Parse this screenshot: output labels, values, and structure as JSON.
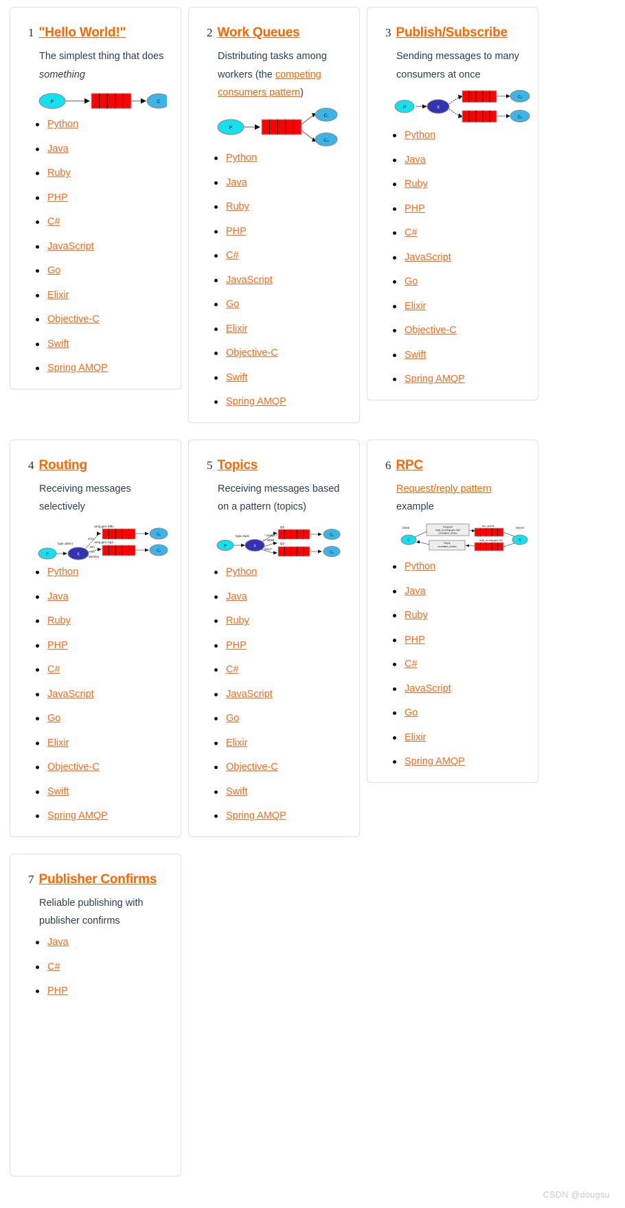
{
  "watermark": "CSDN @dougsu",
  "languages_full": [
    "Python",
    "Java",
    "Ruby",
    "PHP",
    "C#",
    "JavaScript",
    "Go",
    "Elixir",
    "Objective-C",
    "Swift",
    "Spring AMQP"
  ],
  "cards": [
    {
      "number": "1",
      "title": "\"Hello World!\"",
      "desc_prefix": "The simplest thing that does ",
      "desc_em": "something",
      "desc_link": "",
      "desc_suffix": "",
      "diagram": "hello-world-diagram",
      "diagram_labels": {
        "producer": "P",
        "consumer": "C"
      },
      "languages": [
        "Python",
        "Java",
        "Ruby",
        "PHP",
        "C#",
        "JavaScript",
        "Go",
        "Elixir",
        "Objective-C",
        "Swift",
        "Spring AMQP"
      ]
    },
    {
      "number": "2",
      "title": "Work Queues",
      "desc_prefix": "Distributing tasks among workers (the ",
      "desc_em": "",
      "desc_link": "competing consumers pattern",
      "desc_suffix": ")",
      "diagram": "work-queues-diagram",
      "diagram_labels": {
        "producer": "P",
        "consumer1": "C₁",
        "consumer2": "C₂"
      },
      "languages": [
        "Python",
        "Java",
        "Ruby",
        "PHP",
        "C#",
        "JavaScript",
        "Go",
        "Elixir",
        "Objective-C",
        "Swift",
        "Spring AMQP"
      ]
    },
    {
      "number": "3",
      "title": "Publish/Subscribe",
      "desc_prefix": "Sending messages to many consumers at once",
      "desc_em": "",
      "desc_link": "",
      "desc_suffix": "",
      "diagram": "publish-subscribe-diagram",
      "diagram_labels": {
        "producer": "P",
        "exchange": "X",
        "consumer1": "C₁",
        "consumer2": "C₂"
      },
      "languages": [
        "Python",
        "Java",
        "Ruby",
        "PHP",
        "C#",
        "JavaScript",
        "Go",
        "Elixir",
        "Objective-C",
        "Swift",
        "Spring AMQP"
      ]
    },
    {
      "number": "4",
      "title": "Routing",
      "desc_prefix": "Receiving messages selectively",
      "desc_em": "",
      "desc_link": "",
      "desc_suffix": "",
      "diagram": "routing-diagram",
      "diagram_labels": {
        "producer": "P",
        "exchange": "X",
        "exchange_type": "type=direct",
        "queue1": "amq.gen-S9b...",
        "queue2": "amq.gen-Ag1...",
        "key_error": "error",
        "key_info": "info",
        "key_warning": "warning",
        "consumer1": "C₁",
        "consumer2": "C₂"
      },
      "languages": [
        "Python",
        "Java",
        "Ruby",
        "PHP",
        "C#",
        "JavaScript",
        "Go",
        "Elixir",
        "Objective-C",
        "Swift",
        "Spring AMQP"
      ]
    },
    {
      "number": "5",
      "title": "Topics",
      "desc_prefix": "Receiving messages based on a pattern (topics)",
      "desc_em": "",
      "desc_link": "",
      "desc_suffix": "",
      "diagram": "topics-diagram",
      "diagram_labels": {
        "producer": "P",
        "exchange": "X",
        "exchange_type": "type=topic",
        "queue1": "Q1",
        "queue2": "Q2",
        "key1": "*.orange.*",
        "key2": "*.*.rabbit",
        "key3": "lazy.#",
        "consumer1": "C₁",
        "consumer2": "C₂"
      },
      "languages": [
        "Python",
        "Java",
        "Ruby",
        "PHP",
        "C#",
        "JavaScript",
        "Go",
        "Elixir",
        "Objective-C",
        "Swift",
        "Spring AMQP"
      ]
    },
    {
      "number": "6",
      "title": "RPC",
      "desc_prefix": "",
      "desc_em": "",
      "desc_link": "Request/reply pattern",
      "desc_suffix": " example",
      "diagram": "rpc-diagram",
      "diagram_labels": {
        "client": "Client",
        "client_node": "C",
        "server": "Server",
        "server_node": "S",
        "request_box": "Request reply_to=amqp.gen-Xa2 correlation_id=abc",
        "reply_box": "Reply correlation_id=abc",
        "rpc_queue": "rpc_queue",
        "reply_queue": "reply_to=amq.gen-Xa2"
      },
      "languages": [
        "Python",
        "Java",
        "Ruby",
        "PHP",
        "C#",
        "JavaScript",
        "Go",
        "Elixir",
        "Spring AMQP"
      ]
    },
    {
      "number": "7",
      "title": "Publisher Confirms",
      "desc_prefix": "Reliable publishing with publisher confirms",
      "desc_em": "",
      "desc_link": "",
      "desc_suffix": "",
      "diagram": "",
      "diagram_labels": {},
      "languages": [
        "Java",
        "C#",
        "PHP"
      ]
    }
  ],
  "colors": {
    "accent": "#ff6600",
    "link": "#ff6a1f",
    "text": "#2c3e50",
    "queue_red": "#ff0000",
    "producer_cyan": "#16e0eb",
    "consumer_blue": "#3cb4e8",
    "exchange_blue": "#3333b2",
    "card_border": "#e3e3e3",
    "watermark": "#c9c9c9"
  }
}
